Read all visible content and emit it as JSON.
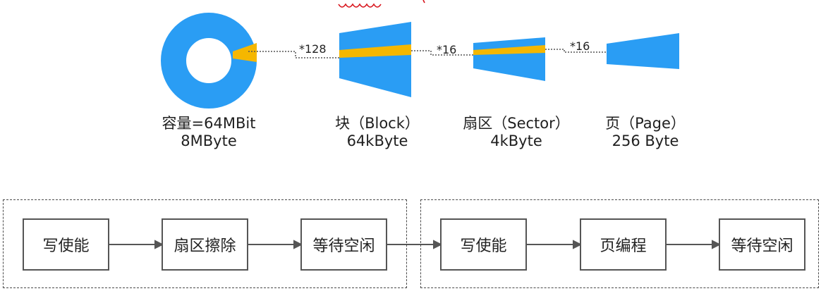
{
  "storage_levels": [
    {
      "id": "chip",
      "caption_line1": "容量=64MBit",
      "caption_line2": "8MByte"
    },
    {
      "id": "block",
      "caption_line1": "块（Block）",
      "caption_line2": "64kByte"
    },
    {
      "id": "sector",
      "caption_line1": "扇区（Sector）",
      "caption_line2": "4kByte"
    },
    {
      "id": "page",
      "caption_line1": "页（Page）",
      "caption_line2": "256 Byte"
    }
  ],
  "multipliers": [
    "*128",
    "*16",
    "*16"
  ],
  "write_flow": {
    "erase_group": [
      "写使能",
      "扇区擦除",
      "等待空闲"
    ],
    "program_group": [
      "写使能",
      "页编程",
      "等待空闲"
    ]
  },
  "colors": {
    "storage_fill": "#2a9df4",
    "highlight_slice": "#f5b700",
    "connector_dots": "#555555",
    "annotation_ink": "#d8141c"
  }
}
